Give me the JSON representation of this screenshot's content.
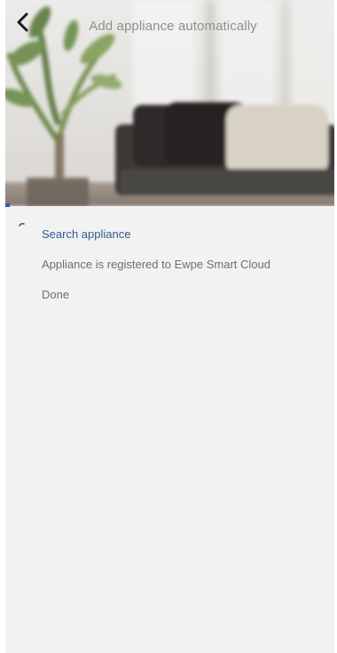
{
  "header": {
    "title": "Add appliance automatically",
    "back_icon": "chevron-left-icon"
  },
  "progress": {
    "fraction": 0.03,
    "color": "#2b5da6"
  },
  "steps": [
    {
      "label": "Search appliance",
      "state": "in-progress",
      "icon": "spinner-icon"
    },
    {
      "label": "Appliance is registered to Ewpe Smart Cloud",
      "state": "pending"
    },
    {
      "label": "Done",
      "state": "pending"
    }
  ],
  "colors": {
    "active_text": "#2f5a8f",
    "pending_text": "#6e6e6e",
    "title_text": "#8f8f8f",
    "background": "#f2f2f2"
  }
}
